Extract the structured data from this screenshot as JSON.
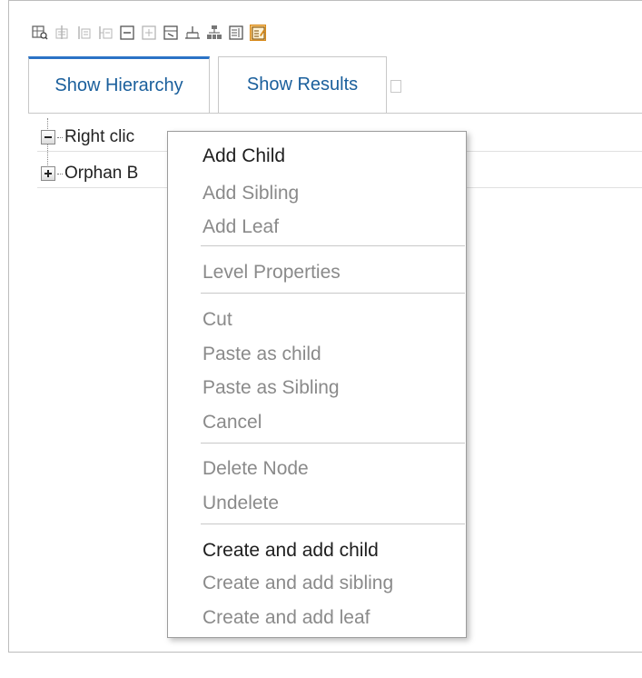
{
  "toolbar": {
    "icons": [
      {
        "name": "find-icon",
        "active": false
      },
      {
        "name": "add-child-icon",
        "active": false
      },
      {
        "name": "add-sibling-icon",
        "active": false
      },
      {
        "name": "add-leaf-icon",
        "active": false
      },
      {
        "name": "collapse-icon",
        "active": false
      },
      {
        "name": "expand-icon",
        "active": false
      },
      {
        "name": "export-icon",
        "active": false
      },
      {
        "name": "hierarchy-icon",
        "active": false
      },
      {
        "name": "org-chart-icon",
        "active": false
      },
      {
        "name": "details-icon",
        "active": false
      },
      {
        "name": "edit-mode-icon",
        "active": true
      }
    ]
  },
  "tabs": [
    {
      "label": "Show Hierarchy",
      "selected": true
    },
    {
      "label": "Show Results",
      "selected": false
    }
  ],
  "tree": {
    "rows": [
      {
        "label": "Right clic",
        "expanded": true
      },
      {
        "label": "Orphan B",
        "expanded": false
      }
    ]
  },
  "context_menu": {
    "items": [
      {
        "label": "Add Child",
        "enabled": true
      },
      {
        "label": "Add Sibling",
        "enabled": false
      },
      {
        "label": "Add Leaf",
        "enabled": false
      },
      {
        "label": "Level Properties",
        "enabled": false
      },
      {
        "label": "Cut",
        "enabled": false
      },
      {
        "label": "Paste as child",
        "enabled": false
      },
      {
        "label": "Paste as Sibling",
        "enabled": false
      },
      {
        "label": "Cancel",
        "enabled": false
      },
      {
        "label": "Delete Node",
        "enabled": false
      },
      {
        "label": "Undelete",
        "enabled": false
      },
      {
        "label": "Create and add child",
        "enabled": true
      },
      {
        "label": "Create and add sibling",
        "enabled": false
      },
      {
        "label": "Create and add leaf",
        "enabled": false
      }
    ]
  },
  "colors": {
    "tab_text": "#1a5f9c",
    "tab_accent": "#2b73c6",
    "menu_disabled": "#8a8a8a",
    "active_icon_bg": "#f4c272"
  }
}
